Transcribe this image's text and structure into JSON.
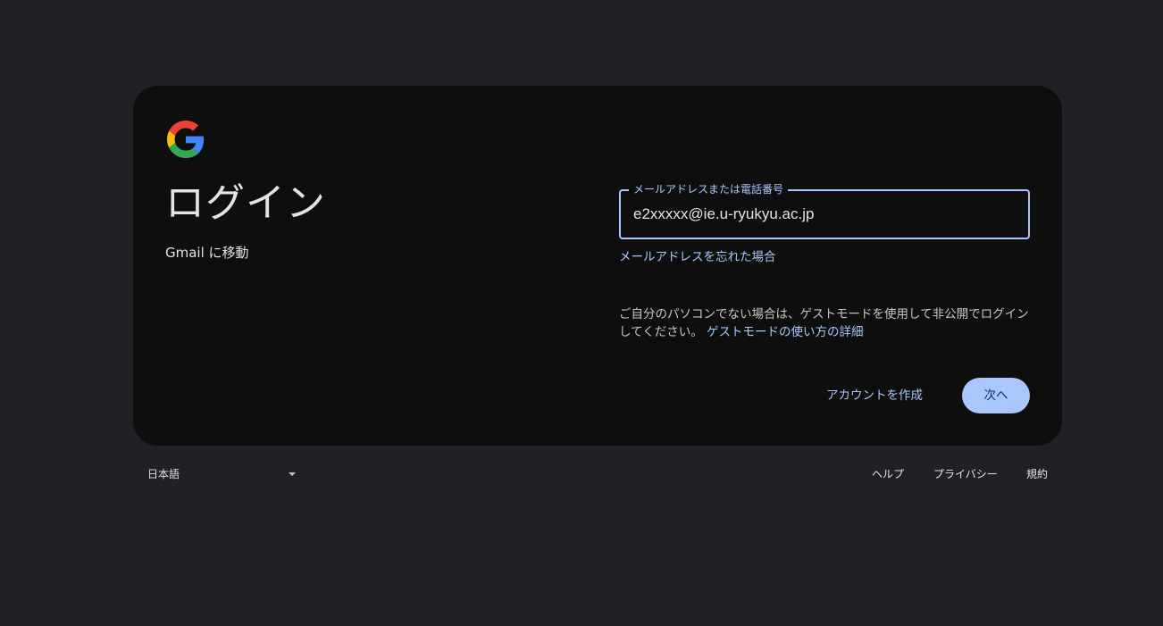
{
  "card": {
    "title": "ログイン",
    "subtitle": "Gmail に移動"
  },
  "email_field": {
    "label": "メールアドレスまたは電話番号",
    "value": "e2xxxxx@ie.u-ryukyu.ac.jp"
  },
  "forgot_email_link": "メールアドレスを忘れた場合",
  "guest_notice": {
    "text": "ご自分のパソコンでない場合は、ゲストモードを使用して非公開でログインしてください。",
    "link": "ゲストモードの使い方の詳細"
  },
  "buttons": {
    "create_account": "アカウントを作成",
    "next": "次へ"
  },
  "footer": {
    "language": "日本語",
    "help": "ヘルプ",
    "privacy": "プライバシー",
    "terms": "規約"
  },
  "colors": {
    "page_background": "#202124",
    "card_background": "#0e0e0f",
    "accent": "#a8c7fa",
    "next_button_text": "#062e6f"
  },
  "icons": {
    "logo": "google-g-logo",
    "language_dropdown": "caret-down-icon"
  }
}
